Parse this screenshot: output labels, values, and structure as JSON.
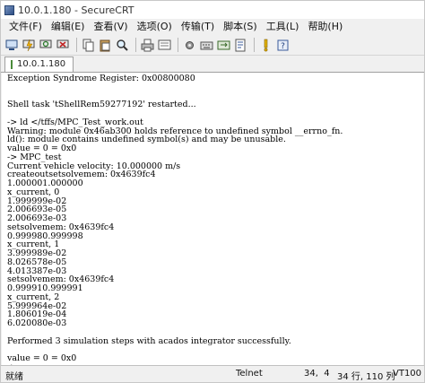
{
  "window": {
    "title": "10.0.1.180 - SecureCRT"
  },
  "menu": [
    "文件(F)",
    "编辑(E)",
    "查看(V)",
    "选项(O)",
    "传输(T)",
    "脚本(S)",
    "工具(L)",
    "帮助(H)"
  ],
  "toolbar": {
    "icons": [
      "connect-icon",
      "quick-connect-icon",
      "reconnect-icon",
      "disconnect-icon",
      "copy-icon",
      "paste-icon",
      "find-icon",
      "print-icon",
      "settings-icon",
      "session-options-icon",
      "keymap-icon",
      "sftp-icon",
      "help-icon",
      "info-icon"
    ]
  },
  "tab": {
    "label": "10.0.1.180"
  },
  "terminal": {
    "lines": [
      "Exception Syndrome Register: 0x00800080",
      "",
      "",
      "Shell task 'tShellRem59277192' restarted...",
      "",
      "-> ld </tffs/MPC_Test_work.out",
      "Warning: module 0x46ab300 holds reference to undefined symbol __errno_fn.",
      "ld(): module contains undefined symbol(s) and may be unusable.",
      "value = 0 = 0x0",
      "-> MPC_test",
      "Current vehicle velocity: 10.000000 m/s",
      "createoutsetsolvemem: 0x4639fc4",
      "1.000001.000000",
      "x_current, 0",
      "1.999999e-02",
      "2.006693e-05",
      "2.006693e-03",
      "setsolvemem: 0x4639fc4",
      "0.999980.999998",
      "x_current, 1",
      "3.999989e-02",
      "8.026578e-05",
      "4.013387e-03",
      "setsolvemem: 0x4639fc4",
      "0.999910.999991",
      "x_current, 2",
      "5.999964e-02",
      "1.806019e-04",
      "6.020080e-03",
      "",
      "Performed 3 simulation steps with acados integrator successfully.",
      "",
      "value = 0 = 0x0",
      "->"
    ]
  },
  "status": {
    "ready": "就绪",
    "protocol": "Telnet",
    "position": "34,  4",
    "size": "34 行, 110 列",
    "emulation": "VT100"
  }
}
